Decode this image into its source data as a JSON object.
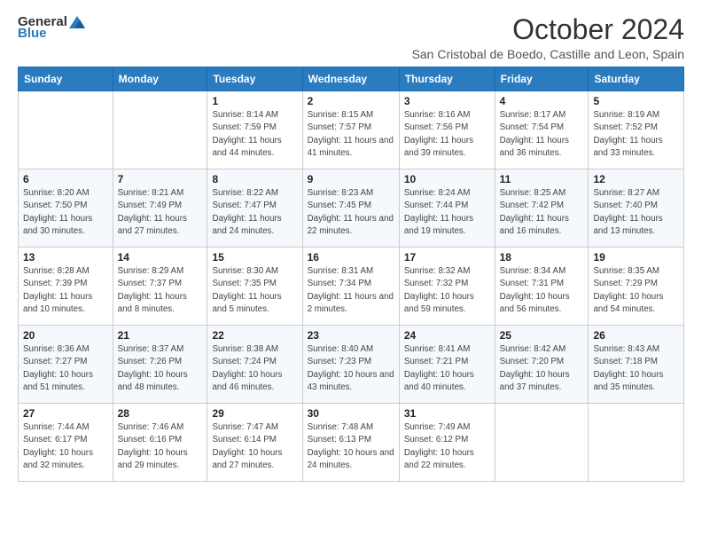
{
  "header": {
    "logo_general": "General",
    "logo_blue": "Blue",
    "title": "October 2024",
    "subtitle": "San Cristobal de Boedo, Castille and Leon, Spain"
  },
  "weekdays": [
    "Sunday",
    "Monday",
    "Tuesday",
    "Wednesday",
    "Thursday",
    "Friday",
    "Saturday"
  ],
  "weeks": [
    [
      {
        "day": "",
        "info": ""
      },
      {
        "day": "",
        "info": ""
      },
      {
        "day": "1",
        "info": "Sunrise: 8:14 AM\nSunset: 7:59 PM\nDaylight: 11 hours and 44 minutes."
      },
      {
        "day": "2",
        "info": "Sunrise: 8:15 AM\nSunset: 7:57 PM\nDaylight: 11 hours and 41 minutes."
      },
      {
        "day": "3",
        "info": "Sunrise: 8:16 AM\nSunset: 7:56 PM\nDaylight: 11 hours and 39 minutes."
      },
      {
        "day": "4",
        "info": "Sunrise: 8:17 AM\nSunset: 7:54 PM\nDaylight: 11 hours and 36 minutes."
      },
      {
        "day": "5",
        "info": "Sunrise: 8:19 AM\nSunset: 7:52 PM\nDaylight: 11 hours and 33 minutes."
      }
    ],
    [
      {
        "day": "6",
        "info": "Sunrise: 8:20 AM\nSunset: 7:50 PM\nDaylight: 11 hours and 30 minutes."
      },
      {
        "day": "7",
        "info": "Sunrise: 8:21 AM\nSunset: 7:49 PM\nDaylight: 11 hours and 27 minutes."
      },
      {
        "day": "8",
        "info": "Sunrise: 8:22 AM\nSunset: 7:47 PM\nDaylight: 11 hours and 24 minutes."
      },
      {
        "day": "9",
        "info": "Sunrise: 8:23 AM\nSunset: 7:45 PM\nDaylight: 11 hours and 22 minutes."
      },
      {
        "day": "10",
        "info": "Sunrise: 8:24 AM\nSunset: 7:44 PM\nDaylight: 11 hours and 19 minutes."
      },
      {
        "day": "11",
        "info": "Sunrise: 8:25 AM\nSunset: 7:42 PM\nDaylight: 11 hours and 16 minutes."
      },
      {
        "day": "12",
        "info": "Sunrise: 8:27 AM\nSunset: 7:40 PM\nDaylight: 11 hours and 13 minutes."
      }
    ],
    [
      {
        "day": "13",
        "info": "Sunrise: 8:28 AM\nSunset: 7:39 PM\nDaylight: 11 hours and 10 minutes."
      },
      {
        "day": "14",
        "info": "Sunrise: 8:29 AM\nSunset: 7:37 PM\nDaylight: 11 hours and 8 minutes."
      },
      {
        "day": "15",
        "info": "Sunrise: 8:30 AM\nSunset: 7:35 PM\nDaylight: 11 hours and 5 minutes."
      },
      {
        "day": "16",
        "info": "Sunrise: 8:31 AM\nSunset: 7:34 PM\nDaylight: 11 hours and 2 minutes."
      },
      {
        "day": "17",
        "info": "Sunrise: 8:32 AM\nSunset: 7:32 PM\nDaylight: 10 hours and 59 minutes."
      },
      {
        "day": "18",
        "info": "Sunrise: 8:34 AM\nSunset: 7:31 PM\nDaylight: 10 hours and 56 minutes."
      },
      {
        "day": "19",
        "info": "Sunrise: 8:35 AM\nSunset: 7:29 PM\nDaylight: 10 hours and 54 minutes."
      }
    ],
    [
      {
        "day": "20",
        "info": "Sunrise: 8:36 AM\nSunset: 7:27 PM\nDaylight: 10 hours and 51 minutes."
      },
      {
        "day": "21",
        "info": "Sunrise: 8:37 AM\nSunset: 7:26 PM\nDaylight: 10 hours and 48 minutes."
      },
      {
        "day": "22",
        "info": "Sunrise: 8:38 AM\nSunset: 7:24 PM\nDaylight: 10 hours and 46 minutes."
      },
      {
        "day": "23",
        "info": "Sunrise: 8:40 AM\nSunset: 7:23 PM\nDaylight: 10 hours and 43 minutes."
      },
      {
        "day": "24",
        "info": "Sunrise: 8:41 AM\nSunset: 7:21 PM\nDaylight: 10 hours and 40 minutes."
      },
      {
        "day": "25",
        "info": "Sunrise: 8:42 AM\nSunset: 7:20 PM\nDaylight: 10 hours and 37 minutes."
      },
      {
        "day": "26",
        "info": "Sunrise: 8:43 AM\nSunset: 7:18 PM\nDaylight: 10 hours and 35 minutes."
      }
    ],
    [
      {
        "day": "27",
        "info": "Sunrise: 7:44 AM\nSunset: 6:17 PM\nDaylight: 10 hours and 32 minutes."
      },
      {
        "day": "28",
        "info": "Sunrise: 7:46 AM\nSunset: 6:16 PM\nDaylight: 10 hours and 29 minutes."
      },
      {
        "day": "29",
        "info": "Sunrise: 7:47 AM\nSunset: 6:14 PM\nDaylight: 10 hours and 27 minutes."
      },
      {
        "day": "30",
        "info": "Sunrise: 7:48 AM\nSunset: 6:13 PM\nDaylight: 10 hours and 24 minutes."
      },
      {
        "day": "31",
        "info": "Sunrise: 7:49 AM\nSunset: 6:12 PM\nDaylight: 10 hours and 22 minutes."
      },
      {
        "day": "",
        "info": ""
      },
      {
        "day": "",
        "info": ""
      }
    ]
  ]
}
